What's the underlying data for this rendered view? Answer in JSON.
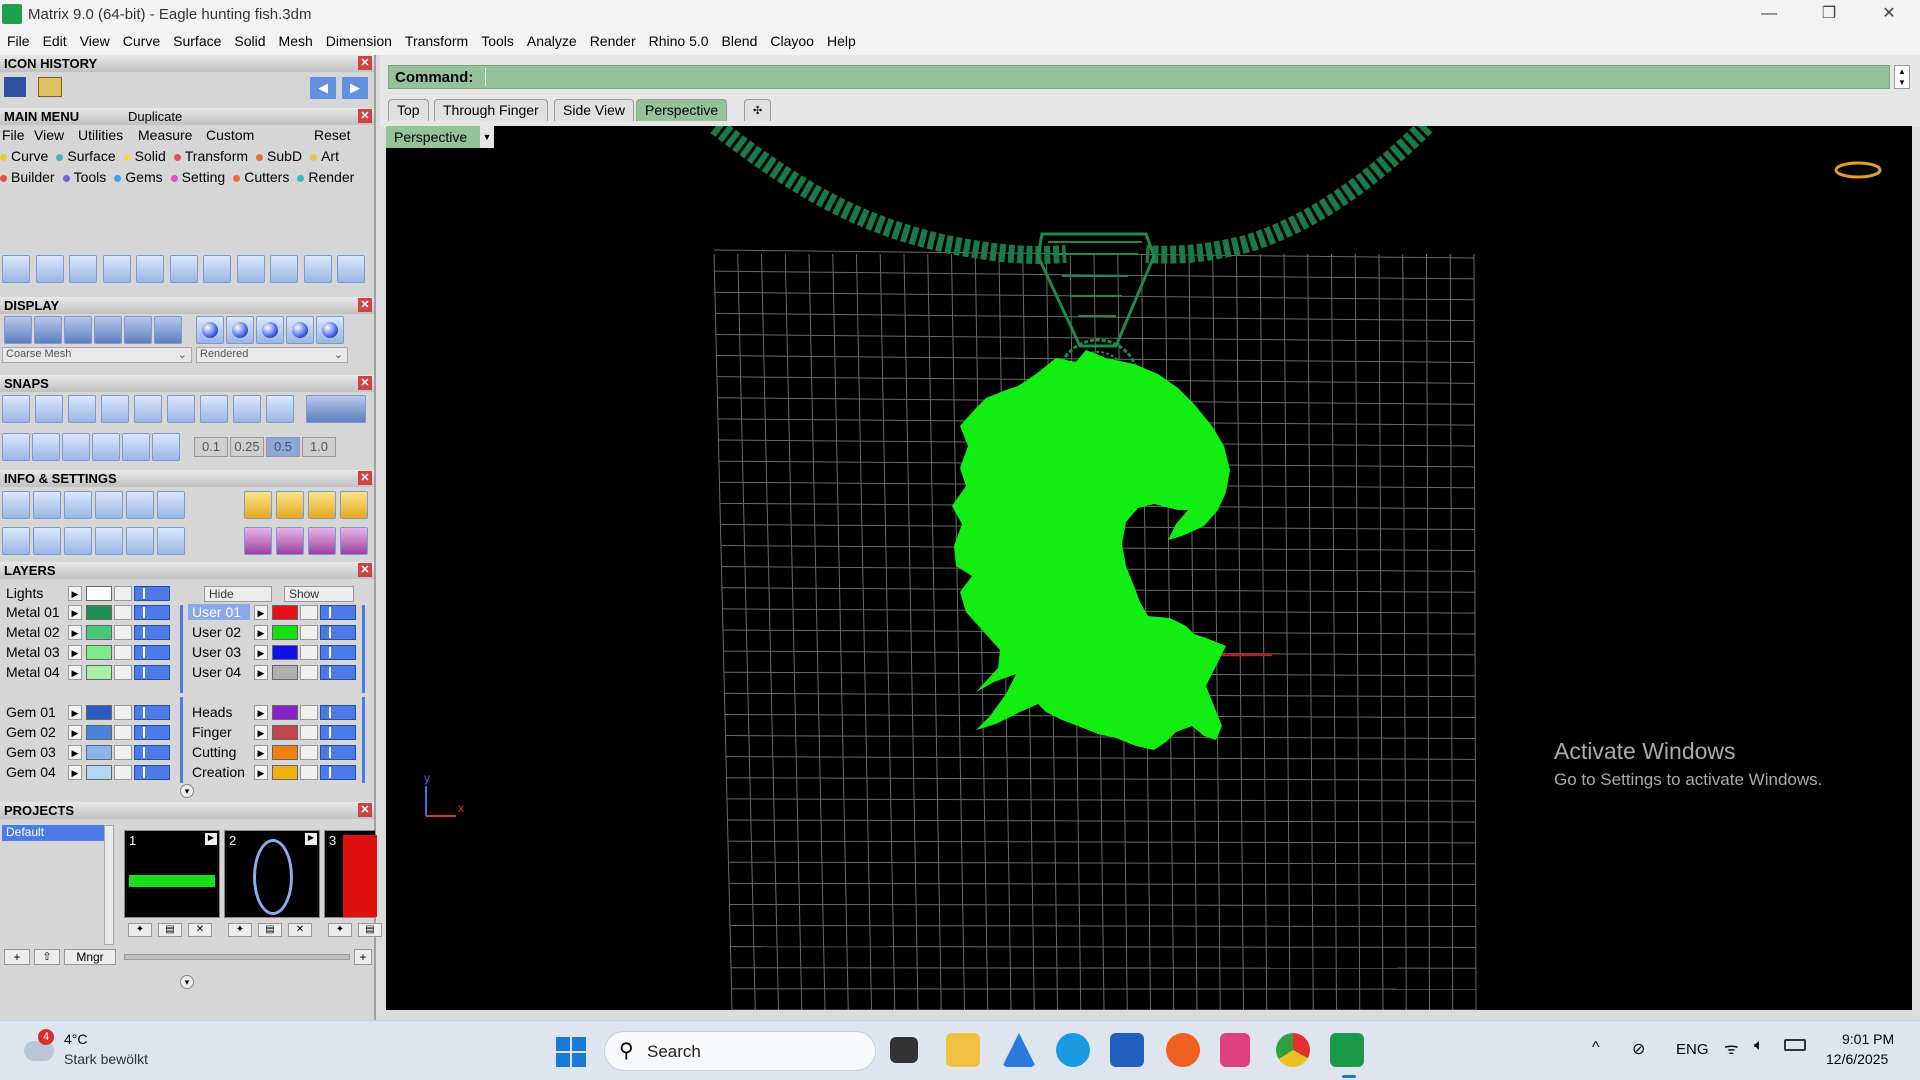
{
  "window": {
    "title": "Matrix 9.0 (64-bit) - Eagle hunting fish.3dm",
    "minimize_glyph": "—",
    "restore_glyph": "❐",
    "close_glyph": "✕"
  },
  "menubar": [
    "File",
    "Edit",
    "View",
    "Curve",
    "Surface",
    "Solid",
    "Mesh",
    "Dimension",
    "Transform",
    "Tools",
    "Analyze",
    "Render",
    "Rhino 5.0",
    "Blend",
    "Clayoo",
    "Help"
  ],
  "left": {
    "icon_history": "ICON HISTORY",
    "main_menu": {
      "title": "MAIN MENU",
      "duplicate": "Duplicate",
      "row1": [
        "File",
        "View",
        "Utilities",
        "Measure",
        "Custom",
        "Reset"
      ],
      "row2": [
        {
          "label": "Curve",
          "color": "#e8c840"
        },
        {
          "label": "Surface",
          "color": "#40b8c8"
        },
        {
          "label": "Solid",
          "color": "#e8e040"
        },
        {
          "label": "Transform",
          "color": "#e85050"
        },
        {
          "label": "SubD",
          "color": "#e87030"
        },
        {
          "label": "Art",
          "color": "#e8c840"
        }
      ],
      "row3": [
        {
          "label": "Builder",
          "color": "#e85050"
        },
        {
          "label": "Tools",
          "color": "#7a60e0"
        },
        {
          "label": "Gems",
          "color": "#40a0e8"
        },
        {
          "label": "Setting",
          "color": "#e050c0"
        },
        {
          "label": "Cutters",
          "color": "#e87030"
        },
        {
          "label": "Render",
          "color": "#40b8c8"
        }
      ]
    },
    "display": {
      "title": "DISPLAY",
      "mesh_select": "Coarse Mesh",
      "render_select": "Rendered"
    },
    "snaps": {
      "title": "SNAPS",
      "values": [
        "0.1",
        "0.25",
        "0.5",
        "1.0"
      ]
    },
    "info": {
      "title": "INFO & SETTINGS"
    },
    "layers": {
      "title": "LAYERS",
      "lights": "Lights",
      "hide": "Hide",
      "show": "Show",
      "left_col": [
        {
          "name": "Metal 01",
          "color": "#1e8e4e"
        },
        {
          "name": "Metal 02",
          "color": "#46c878"
        },
        {
          "name": "Metal 03",
          "color": "#7eea8a"
        },
        {
          "name": "Metal 04",
          "color": "#a8f0a8"
        },
        {
          "name": "Gem 01",
          "color": "#2a5cc0"
        },
        {
          "name": "Gem 02",
          "color": "#4a84d8"
        },
        {
          "name": "Gem 03",
          "color": "#8cb4ec"
        },
        {
          "name": "Gem 04",
          "color": "#b4d4f4"
        }
      ],
      "right_col": [
        {
          "name": "User 01",
          "color": "#e81010"
        },
        {
          "name": "User 02",
          "color": "#10e010"
        },
        {
          "name": "User 03",
          "color": "#1010e8"
        },
        {
          "name": "User 04",
          "color": "#b0b0b0"
        },
        {
          "name": "Heads",
          "color": "#8a20c8"
        },
        {
          "name": "Finger",
          "color": "#c04848"
        },
        {
          "name": "Cutting",
          "color": "#f08010"
        },
        {
          "name": "Creation",
          "color": "#f0b010"
        }
      ]
    },
    "projects": {
      "title": "PROJECTS",
      "default": "Default",
      "slots": [
        "1",
        "2",
        "3"
      ],
      "mngr": "Mngr"
    }
  },
  "command": {
    "label": "Command:",
    "value": ""
  },
  "tabs": [
    "Top",
    "Through Finger",
    "Side View",
    "Perspective",
    "✣"
  ],
  "active_tab": "Perspective",
  "viewport": {
    "label": "Perspective",
    "axis_x": "x",
    "axis_y": "y"
  },
  "watermark": {
    "title": "Activate Windows",
    "subtitle": "Go to Settings to activate Windows."
  },
  "taskbar": {
    "weather_temp": "4°C",
    "weather_text": "Stark bewölkt",
    "weather_badge": "4",
    "search": "Search",
    "lang": "ENG",
    "time": "9:01 PM",
    "date": "12/6/2025"
  }
}
